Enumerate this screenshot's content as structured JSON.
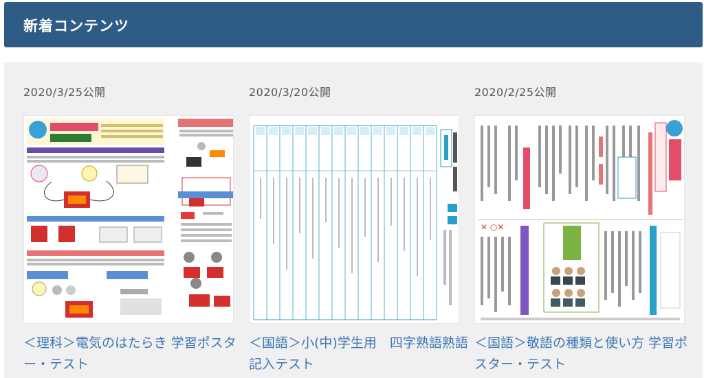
{
  "header": {
    "title": "新着コンテンツ"
  },
  "cards": [
    {
      "date": "2020/3/25公開",
      "title": "＜理科＞電気のはたらき 学習ポスター・テスト"
    },
    {
      "date": "2020/3/20公開",
      "title": "＜国語＞小(中)学生用　四字熟語熟語記入テスト"
    },
    {
      "date": "2020/2/25公開",
      "title": "＜国語＞敬語の種類と使い方 学習ポスター・テスト"
    }
  ]
}
